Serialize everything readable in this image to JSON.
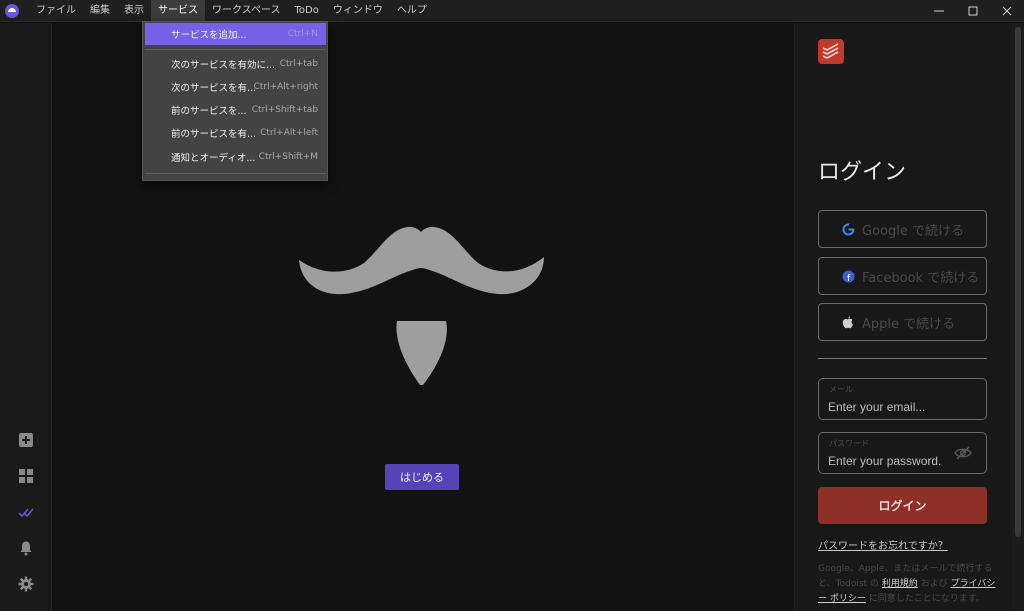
{
  "menubar": {
    "items": [
      "ファイル",
      "編集",
      "表示",
      "サービス",
      "ワークスペース",
      "ToDo",
      "ウィンドウ",
      "ヘルプ"
    ],
    "active_index": 3
  },
  "window_controls": [
    "minimize-icon",
    "maximize-icon",
    "close-icon"
  ],
  "services_menu": {
    "items": [
      {
        "label": "サービスを追加...",
        "shortcut": "Ctrl+N",
        "highlighted": true
      },
      {
        "label": "次のサービスを有効に...",
        "shortcut": "Ctrl+tab"
      },
      {
        "label": "次のサービスを有...",
        "shortcut": "Ctrl+Alt+right"
      },
      {
        "label": "前のサービスを...",
        "shortcut": "Ctrl+Shift+tab"
      },
      {
        "label": "前のサービスを有...",
        "shortcut": "Ctrl+Alt+left"
      },
      {
        "label": "通知とオーディオ...",
        "shortcut": "Ctrl+Shift+M"
      }
    ]
  },
  "sidebar": {
    "icons": [
      "add-service-icon",
      "workspaces-icon",
      "todo-checkmark-icon",
      "notifications-bell-icon",
      "settings-gear-icon"
    ]
  },
  "main": {
    "start_button": "はじめる"
  },
  "login_panel": {
    "title": "ログイン",
    "google_button": "Google で続ける",
    "facebook_button": "Facebook で続ける",
    "apple_button": "Apple で続ける",
    "email_label": "メール",
    "email_placeholder": "Enter your email...",
    "password_label": "パスワード",
    "password_placeholder": "Enter your password...",
    "login_button": "ログイン",
    "forgot_password": "パスワードをお忘れですか？",
    "terms_prefix": "Google、Apple、またはメールで続行すると、Todoist の",
    "terms_link": "利用規約",
    "terms_middle": "および",
    "privacy_link": "プライバシー ポリシー",
    "terms_suffix": "に同意したことになります。"
  },
  "colors": {
    "accent": "#7761e6",
    "start_button": "#5643b5",
    "login_button": "#8e3027",
    "todoist_red": "#c0392b"
  }
}
